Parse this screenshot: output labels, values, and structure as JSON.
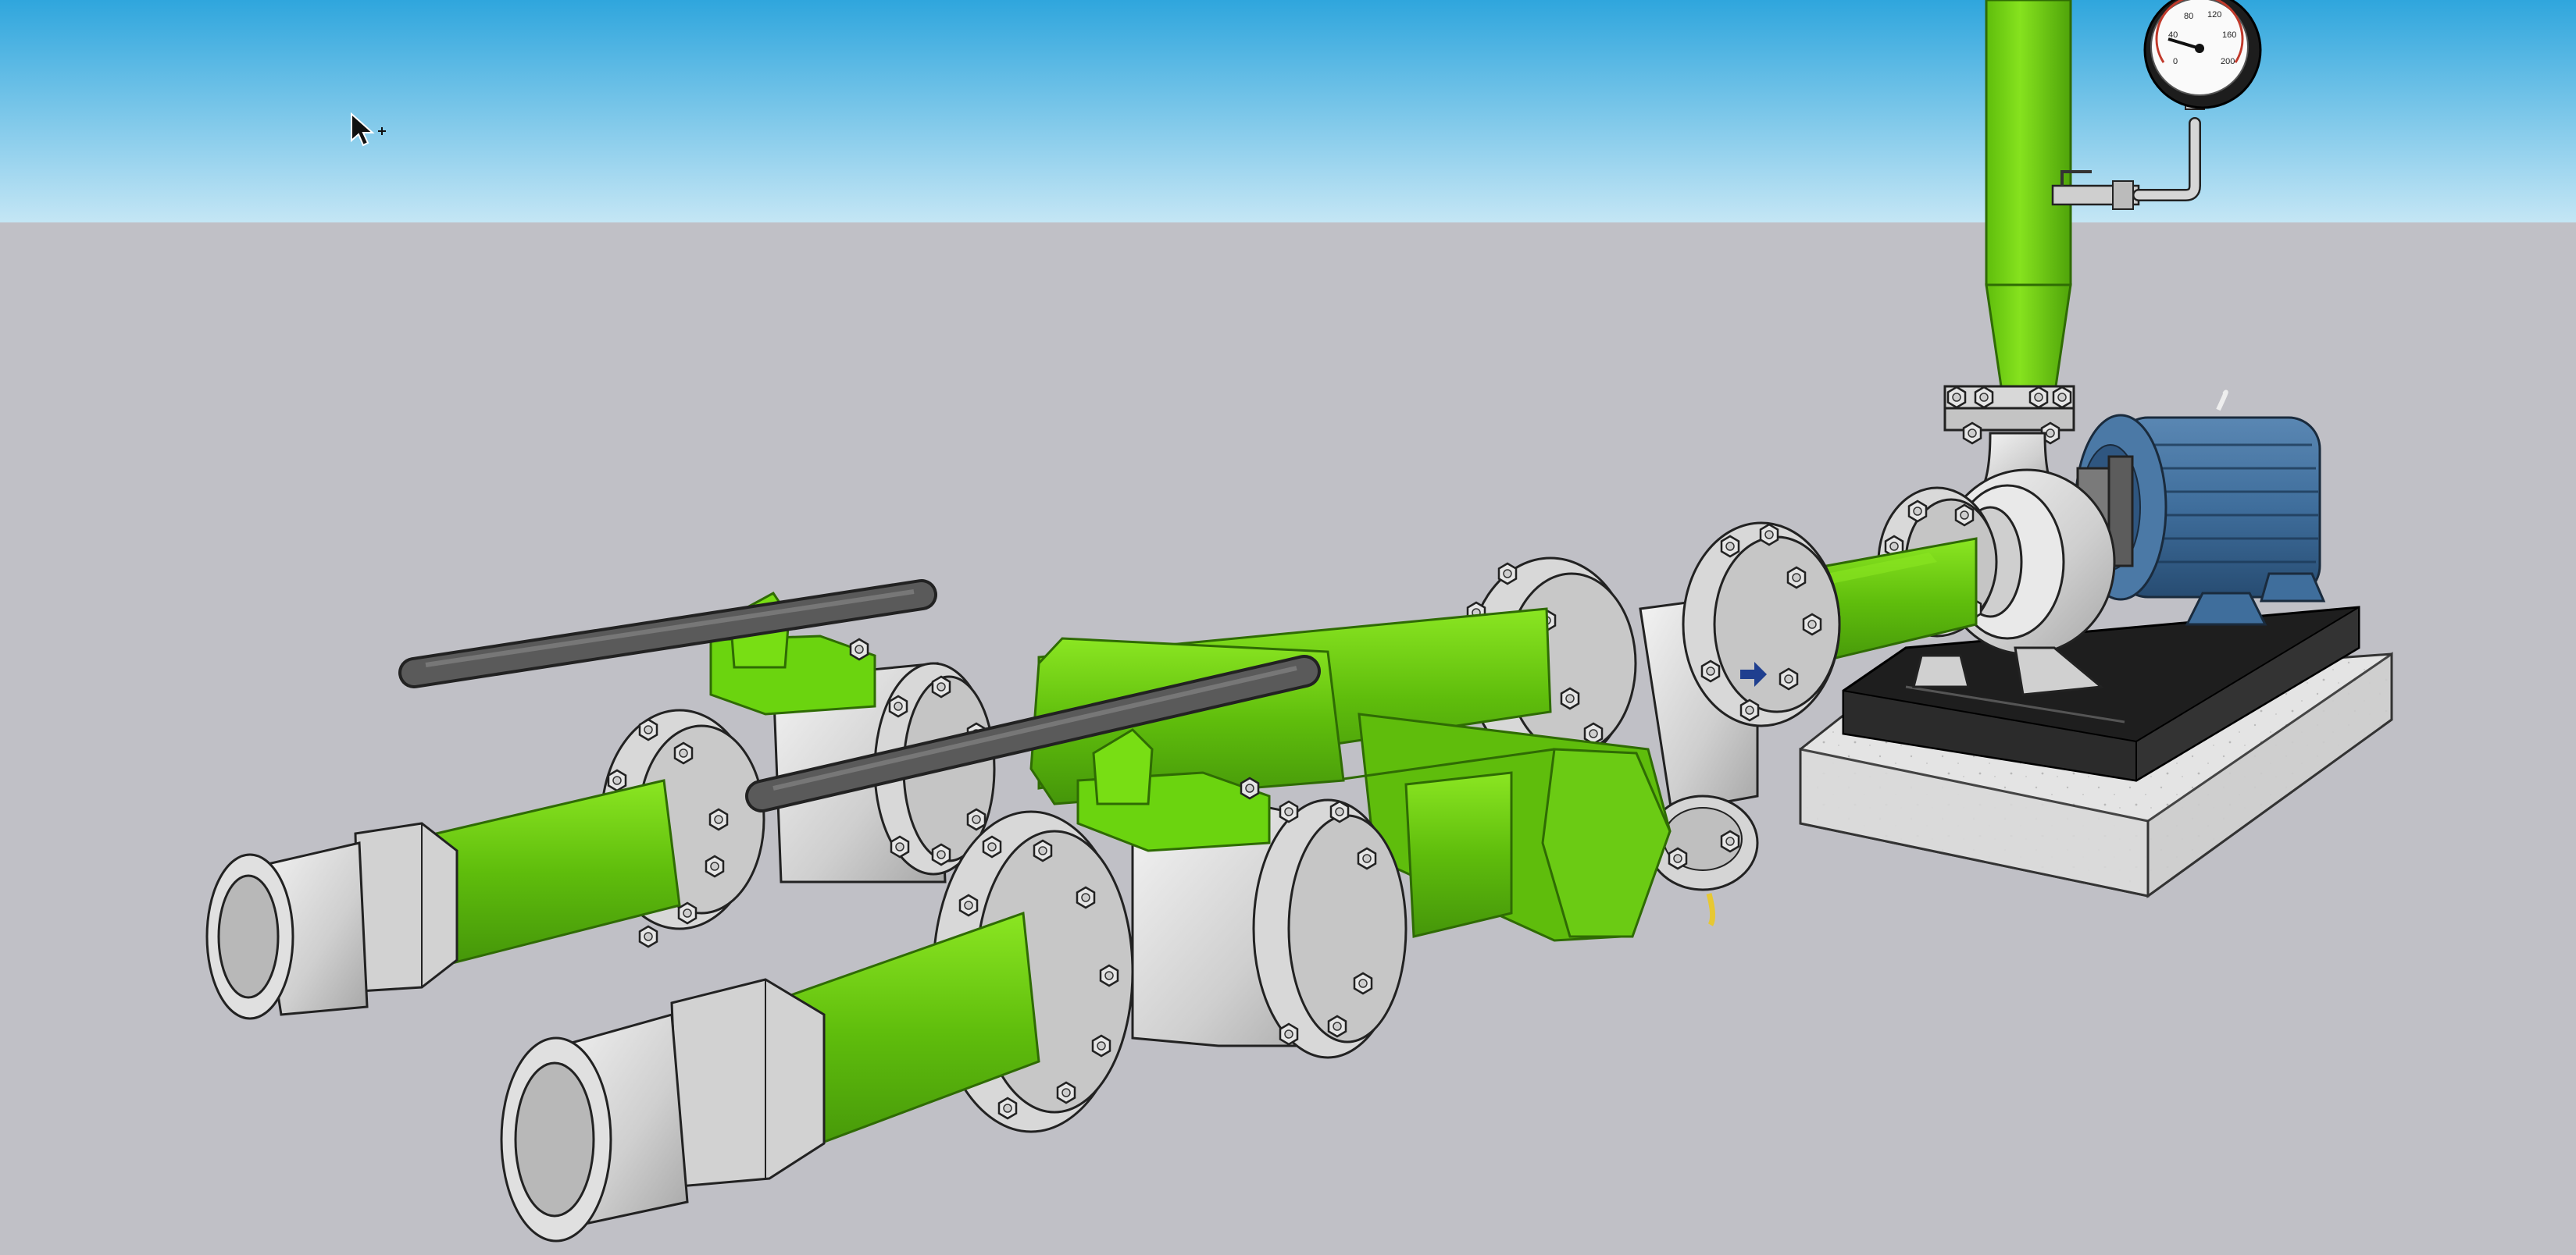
{
  "scene": {
    "sky_top": "#2fa6dd",
    "sky_bottom": "#bfe3f3",
    "ground": "#c0c0c6",
    "pipe_green": "#5fbd0c",
    "pipe_green_light": "#7fe01c",
    "pipe_green_dark": "#3f8a06",
    "steel": "#d2d2d2",
    "steel_light": "#f0f0f0",
    "steel_dark": "#9a9a9a",
    "handle": "#5a5a5a",
    "motor_blue": "#3f6e9c",
    "motor_dark": "#26486a",
    "base_black": "#222222",
    "concrete": "#e6e6e6",
    "outline": "#222222",
    "arrow_blue": "#1f3f8f",
    "cable_yellow": "#e7c832"
  },
  "icons": {
    "cursor": "select-cursor-icon",
    "arrow": "flow-direction-arrow-icon"
  },
  "gauge": {
    "ticks": [
      "0",
      "40",
      "80",
      "120",
      "160",
      "200"
    ]
  }
}
